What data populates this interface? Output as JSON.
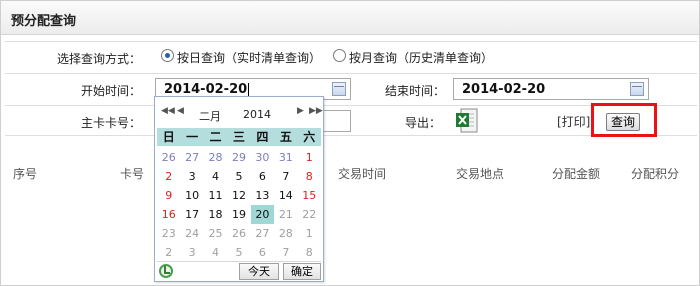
{
  "panel": {
    "title": "预分配查询"
  },
  "form": {
    "mode_label": "选择查询方式：",
    "mode_options": [
      {
        "label": "按日查询（实时清单查询）",
        "checked": true
      },
      {
        "label": "按月查询（历史清单查询）",
        "checked": false
      }
    ],
    "start_label": "开始时间：",
    "start_value": "2014-02-20",
    "end_label": "结束时间：",
    "end_value": "2014-02-20",
    "card_label": "主卡卡号：",
    "card_value": "",
    "export_label": "导出：",
    "export_icon": "excel-icon",
    "print_link": "[打印]",
    "query_button": "查询"
  },
  "table": {
    "columns": [
      "序号",
      "卡号",
      "交易时间",
      "交易地点",
      "分配金额",
      "分配积分"
    ]
  },
  "calendar": {
    "month": "二月",
    "year": "2014",
    "nav": {
      "prev_year": "◀◀",
      "prev_month": "◀",
      "next_month": "▶",
      "next_year": "▶▶"
    },
    "weekdays": [
      "日",
      "一",
      "二",
      "三",
      "四",
      "五",
      "六"
    ],
    "weeks": [
      [
        "26",
        "27",
        "28",
        "29",
        "30",
        "31",
        "1"
      ],
      [
        "2",
        "3",
        "4",
        "5",
        "6",
        "7",
        "8"
      ],
      [
        "9",
        "10",
        "11",
        "12",
        "13",
        "14",
        "15"
      ],
      [
        "16",
        "17",
        "18",
        "19",
        "20",
        "21",
        "22"
      ],
      [
        "23",
        "24",
        "25",
        "26",
        "27",
        "28",
        "1"
      ],
      [
        "2",
        "3",
        "4",
        "5",
        "6",
        "7",
        "8"
      ]
    ],
    "selected": "20",
    "today_button": "今天",
    "ok_button": "确定",
    "clear_icon": "clear-icon"
  },
  "colors": {
    "highlight": "#ee1111",
    "weekday_header": "#b4dede",
    "selected_day": "#9fd6d6",
    "sunday": "#e02020"
  }
}
